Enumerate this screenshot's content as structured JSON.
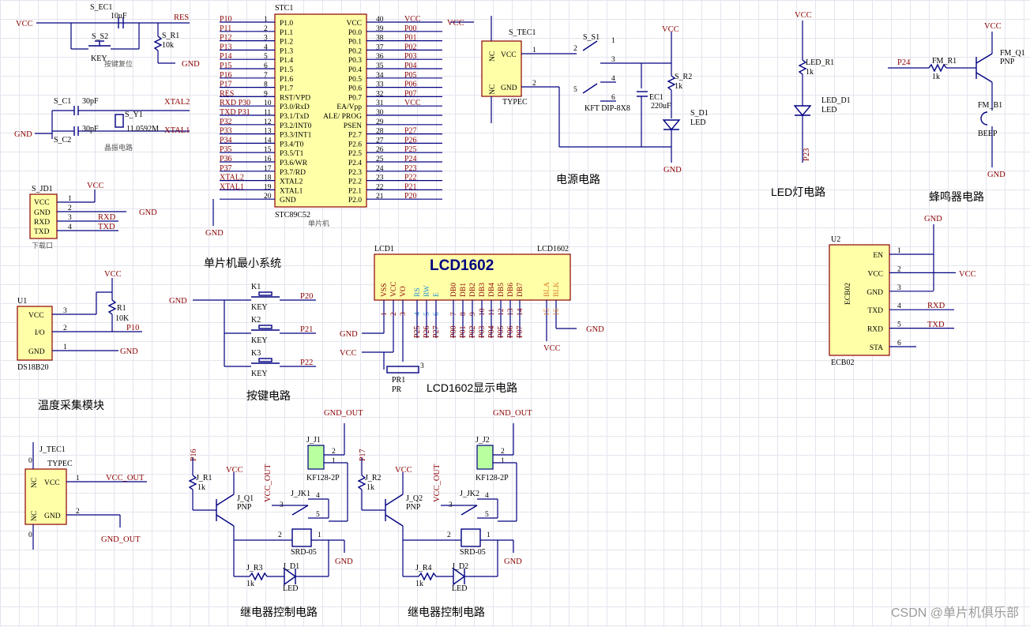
{
  "watermark": "CSDN @单片机俱乐部",
  "section_titles": {
    "mcu": "单片机最小系统",
    "power": "电源电路",
    "led": "LED灯电路",
    "buzzer": "蜂鸣器电路",
    "temp": "温度采集模块",
    "keys": "按键电路",
    "lcd": "LCD1602显示电路",
    "relay1": "继电器控制电路",
    "relay2": "继电器控制电路"
  },
  "reset": {
    "cap_ref": "S_EC1",
    "cap_val": "10uF",
    "sw_ref": "S_S2",
    "sw_val": "KEY",
    "sw_note": "按键复位",
    "res_ref": "S_R1",
    "res_val": "10k",
    "vcc": "VCC",
    "gnd": "GND",
    "net": "RES"
  },
  "crystal": {
    "c1_ref": "S_C1",
    "c1_val": "30pF",
    "c2_ref": "S_C2",
    "c2_val": "30pF",
    "y_ref": "S_Y1",
    "y_val": "11.0592M",
    "note": "晶振电路",
    "net1": "XTAL2",
    "net2": "XTAL1",
    "gnd": "GND"
  },
  "download": {
    "ref": "S_JD1",
    "pins": [
      "VCC",
      "GND",
      "RXD",
      "TXD"
    ],
    "nums": [
      "1",
      "2",
      "3",
      "4"
    ],
    "note": "下载口",
    "vcc": "VCC",
    "gnd": "GND",
    "rxd": "RXD",
    "txd": "TXD"
  },
  "mcu": {
    "ref": "STC1",
    "part": "STC89C52",
    "note": "单片机",
    "gnd": "GND",
    "left_pins": [
      "P1.0",
      "P1.1",
      "P1.2",
      "P1.3",
      "P1.4",
      "P1.5",
      "P1.6",
      "P1.7",
      "RST/VPD",
      "P3.0/RxD",
      "P3.1/TxD",
      "P3.2/INT0",
      "P3.3/INT1",
      "P3.4/T0",
      "P3.5/T1",
      "P3.6/WR",
      "P3.7/RD",
      "XTAL2",
      "XTAL1",
      "GND"
    ],
    "left_nums": [
      "1",
      "2",
      "3",
      "4",
      "5",
      "6",
      "7",
      "8",
      "9",
      "10",
      "11",
      "12",
      "13",
      "14",
      "15",
      "16",
      "17",
      "18",
      "19",
      "20"
    ],
    "left_nets": [
      "P10",
      "P11",
      "P12",
      "P13",
      "P14",
      "P15",
      "P16",
      "P17",
      "RES",
      "RXD P30",
      "TXD P31",
      "P32",
      "P33",
      "P34",
      "P35",
      "P36",
      "P37",
      "XTAL2",
      "XTAL1",
      ""
    ],
    "right_pins": [
      "VCC",
      "P0.0",
      "P0.1",
      "P0.2",
      "P0.3",
      "P0.4",
      "P0.5",
      "P0.6",
      "P0.7",
      "EA/Vpp",
      "ALE/ PROG",
      "PSEN",
      "P2.7",
      "P2.6",
      "P2.5",
      "P2.4",
      "P2.3",
      "P2.2",
      "P2.1",
      "P2.0"
    ],
    "right_nums": [
      "40",
      "39",
      "38",
      "37",
      "36",
      "35",
      "34",
      "33",
      "32",
      "31",
      "30",
      "29",
      "28",
      "27",
      "26",
      "25",
      "24",
      "23",
      "22",
      "21"
    ],
    "right_nets": [
      "VCC",
      "P00",
      "P01",
      "P02",
      "P03",
      "P04",
      "P05",
      "P06",
      "P07",
      "VCC",
      "",
      "",
      "P27",
      "P26",
      "P25",
      "P24",
      "P23",
      "P22",
      "P21",
      "P20"
    ]
  },
  "ds18b20": {
    "ref": "U1",
    "part": "DS18B20",
    "pins": [
      "VCC",
      "I/O",
      "GND"
    ],
    "nums": [
      "3",
      "2",
      "1"
    ],
    "r_ref": "R1",
    "r_val": "10K",
    "vcc": "VCC",
    "net": "P10",
    "gnd": "GND"
  },
  "keys": {
    "gnd": "GND",
    "items": [
      {
        "ref": "K1",
        "val": "KEY",
        "net": "P20"
      },
      {
        "ref": "K2",
        "val": "KEY",
        "net": "P21"
      },
      {
        "ref": "K3",
        "val": "KEY",
        "net": "P22"
      }
    ]
  },
  "lcd": {
    "ref": "LCD1",
    "part": "LCD1602",
    "title": "LCD1602",
    "pins": [
      "VSS",
      "VCC",
      "VO",
      "RS",
      "RW",
      "E",
      "DB0",
      "DB1",
      "DB2",
      "DB3",
      "DB4",
      "DB5",
      "DB6",
      "DB7",
      "BLA",
      "BLK"
    ],
    "nums": [
      "1",
      "2",
      "3",
      "4",
      "5",
      "6",
      "7",
      "8",
      "9",
      "10",
      "11",
      "12",
      "13",
      "14",
      "15",
      "16"
    ],
    "nets": [
      "",
      "",
      "",
      "P25",
      "P26",
      "P27",
      "P00",
      "P01",
      "P02",
      "P03",
      "P04",
      "P05",
      "P06",
      "P07",
      "",
      ""
    ],
    "gnd": "GND",
    "vcc": "VCC",
    "pot_ref": "PR1",
    "pot_val": "PR",
    "pot_pin": "3",
    "bl_vcc": "VCC",
    "bl_gnd": "GND"
  },
  "power": {
    "conn_ref": "S_TEC1",
    "conn_val": "TYPEC",
    "conn_pins": [
      "VCC",
      "GND"
    ],
    "conn_nc": "NC",
    "sw_ref": "S_S1",
    "sw_val": "KFT DIP-8X8",
    "sw_nums": [
      "1",
      "2",
      "3",
      "4",
      "5",
      "6"
    ],
    "cap_ref": "EC1",
    "cap_val": "220uF",
    "res_ref": "S_R2",
    "res_val": "1k",
    "led_ref": "S_D1",
    "led_val": "LED",
    "vcc": "VCC",
    "gnd": "GND",
    "vcc_out": "VCC",
    "pin_nums": [
      "1",
      "2"
    ]
  },
  "led": {
    "vcc": "VCC",
    "r_ref": "LED_R1",
    "r_val": "1k",
    "d_ref": "LED_D1",
    "d_val": "LED",
    "net": "P23"
  },
  "buzzer": {
    "q_ref": "FM_Q1",
    "q_val": "PNP",
    "r_ref": "FM_R1",
    "r_val": "1k",
    "b_ref": "FM_B1",
    "b_val": "BEEP",
    "net": "P24",
    "vcc": "VCC",
    "gnd": "GND"
  },
  "ecb": {
    "ref": "U2",
    "part": "ECB02",
    "label": "ECB02",
    "pins": [
      "EN",
      "VCC",
      "GND",
      "TXD",
      "RXD",
      "STA"
    ],
    "nums": [
      "1",
      "2",
      "3",
      "4",
      "5",
      "6"
    ],
    "gnd": "GND",
    "vcc": "VCC",
    "rxd": "RXD",
    "txd": "TXD"
  },
  "usb_out": {
    "ref": "J_TEC1",
    "val": "TYPEC",
    "pins": [
      "VCC",
      "GND"
    ],
    "nc": "NC",
    "nums": [
      "1",
      "2"
    ],
    "vcc_out": "VCC_OUT",
    "gnd_out": "GND_OUT",
    "zero": "0"
  },
  "relay1": {
    "net": "P16",
    "r1_ref": "J_R1",
    "r1_val": "1k",
    "q_ref": "J_Q1",
    "q_val": "PNP",
    "vcc": "VCC",
    "vcc_out": "VCC_OUT",
    "gnd_out": "GND_OUT",
    "j_ref": "J_J1",
    "j_val": "KF128-2P",
    "k_ref": "J_JK1",
    "k_val": "SRD-05",
    "r3_ref": "J_R3",
    "r3_val": "1k",
    "d_ref": "J_D1",
    "d_val": "LED",
    "gnd": "GND",
    "k_nums": [
      "3",
      "4",
      "5",
      "2",
      "1"
    ],
    "j_nums": [
      "2",
      "1"
    ]
  },
  "relay2": {
    "net": "P17",
    "r1_ref": "J_R2",
    "r1_val": "1k",
    "q_ref": "J_Q2",
    "q_val": "PNP",
    "vcc": "VCC",
    "vcc_out": "VCC_OUT",
    "gnd_out": "GND_OUT",
    "j_ref": "J_J2",
    "j_val": "KF128-2P",
    "k_ref": "J_JK2",
    "k_val": "SRD-05",
    "r3_ref": "J_R4",
    "r3_val": "1k",
    "d_ref": "J_D2",
    "d_val": "LED",
    "gnd": "GND",
    "k_nums": [
      "3",
      "4",
      "5",
      "2",
      "1"
    ],
    "j_nums": [
      "2",
      "1"
    ]
  }
}
